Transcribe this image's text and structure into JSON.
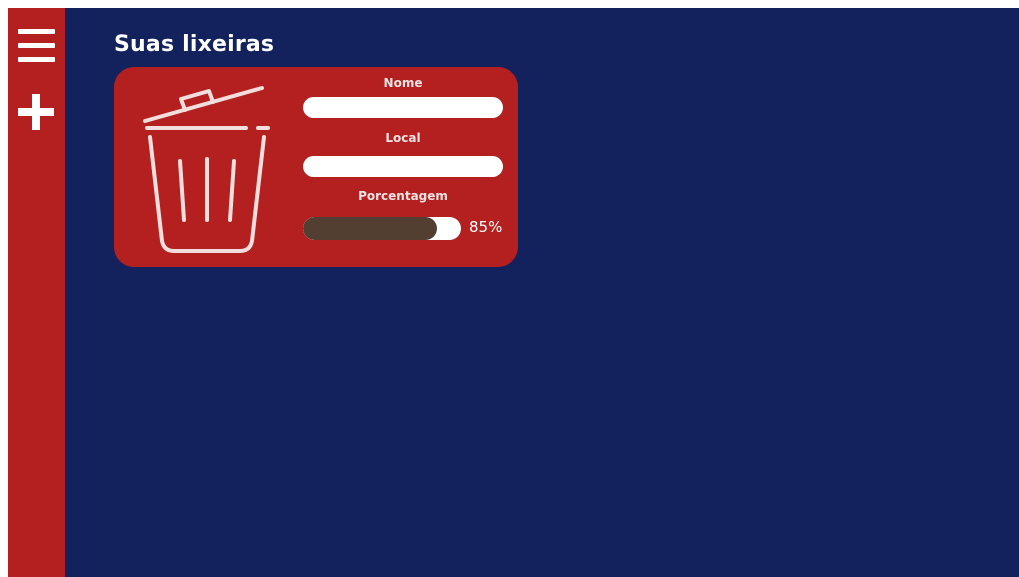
{
  "page": {
    "title": "Suas lixeiras"
  },
  "sidebar": {
    "menu_icon": "menu-icon",
    "add_icon": "plus-icon"
  },
  "card": {
    "icon": "trash-can-icon",
    "name_label": "Nome",
    "name_value": "",
    "local_label": "Local",
    "local_value": "",
    "percent_label": "Porcentagem",
    "percent_text": "85%",
    "percent_value": 85
  },
  "colors": {
    "background": "#13215d",
    "sidebar": "#b3201f",
    "card": "#b3201f",
    "fill": "#533f32",
    "text": "#ffffff"
  }
}
